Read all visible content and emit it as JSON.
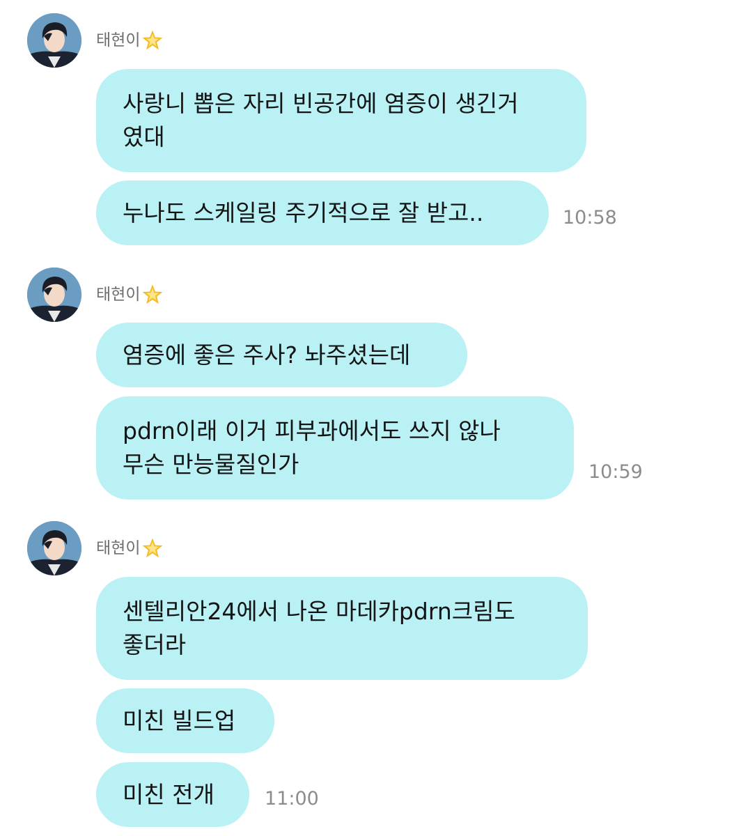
{
  "colors": {
    "bubble": "#baf1f5",
    "sender_name": "#6f6f6f",
    "timestamp": "#8c8c8c"
  },
  "groups": [
    {
      "sender": {
        "name": "태현이",
        "badge_icon": "star-icon",
        "avatar_icon": "profile-avatar"
      },
      "messages": [
        {
          "text": "사랑니 뽑은 자리 빈공간에 염증이 생긴거\n였대"
        },
        {
          "text": "누나도 스케일링 주기적으로 잘 받고.."
        }
      ],
      "time": "10:58"
    },
    {
      "sender": {
        "name": "태현이",
        "badge_icon": "star-icon",
        "avatar_icon": "profile-avatar"
      },
      "messages": [
        {
          "text": "염증에 좋은 주사? 놔주셨는데"
        },
        {
          "text": "pdrn이래 이거 피부과에서도 쓰지 않나\n무슨 만능물질인가"
        }
      ],
      "time": "10:59"
    },
    {
      "sender": {
        "name": "태현이",
        "badge_icon": "star-icon",
        "avatar_icon": "profile-avatar"
      },
      "messages": [
        {
          "text": "센텔리안24에서 나온 마데카pdrn크림도\n좋더라"
        },
        {
          "text": "미친 빌드업"
        },
        {
          "text": "미친 전개"
        }
      ],
      "time": "11:00"
    }
  ]
}
